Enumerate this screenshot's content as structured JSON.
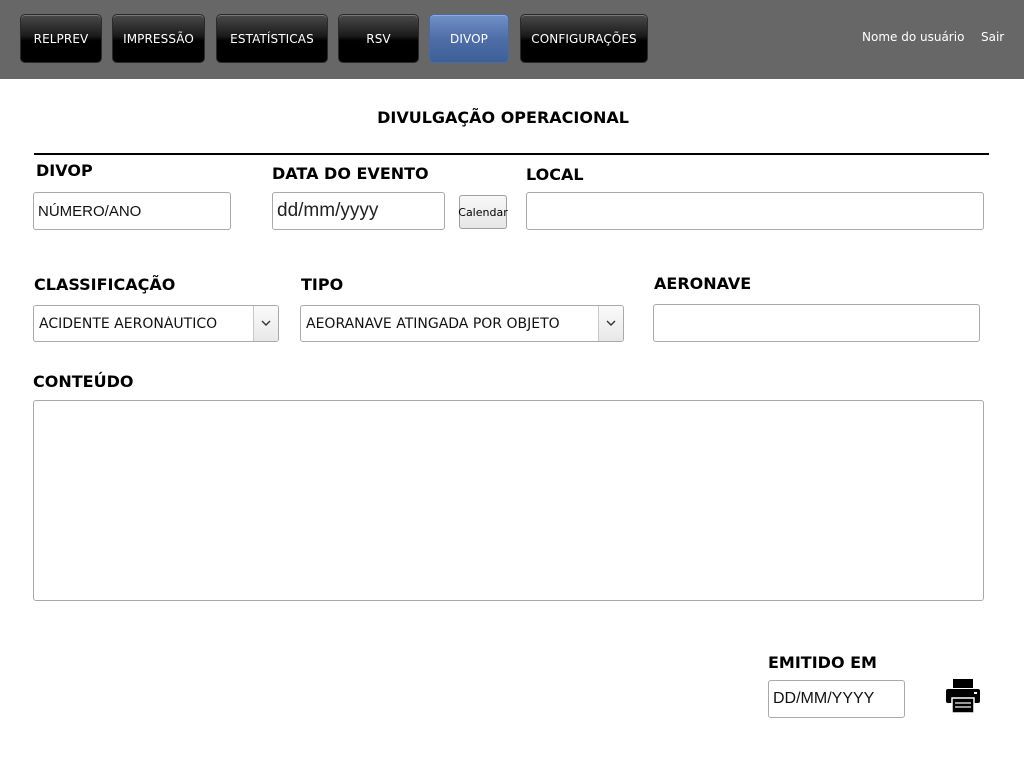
{
  "nav": {
    "items": [
      {
        "label": "RELPREV"
      },
      {
        "label": "IMPRESSÃO"
      },
      {
        "label": "ESTATÍSTICAS"
      },
      {
        "label": "RSV"
      },
      {
        "label": "DIVOP",
        "active": true
      },
      {
        "label": "CONFIGURAÇÕES"
      }
    ],
    "user_name": "Nome do usuário",
    "logout": "Sair"
  },
  "colors": {
    "topbar": "#676767",
    "active_tab": "#4f6ea8",
    "tab": "#000000"
  },
  "form": {
    "title": "DIVULGAÇÃO OPERACIONAL",
    "divop": {
      "label": "DIVOP",
      "value": "NÚMERO/ANO"
    },
    "event_date": {
      "label": "DATA DO EVENTO",
      "placeholder": "dd/mm/yyyy",
      "calendar_button": "Calendar"
    },
    "local": {
      "label": "LOCAL",
      "value": ""
    },
    "classification": {
      "label": "CLASSIFICAÇÃO",
      "selected": "ACIDENTE AERONÁUTICO"
    },
    "type": {
      "label": "TIPO",
      "selected": "AEORANAVE ATINGADA POR OBJETO"
    },
    "aircraft": {
      "label": "AERONAVE",
      "value": ""
    },
    "content": {
      "label": "CONTEÚDO",
      "value": ""
    },
    "issued": {
      "label": "EMITIDO EM",
      "value": "DD/MM/YYYY"
    },
    "print_icon": "printer-icon"
  }
}
